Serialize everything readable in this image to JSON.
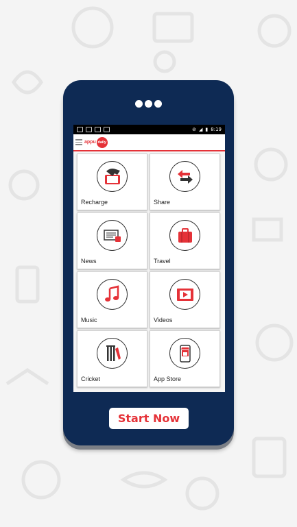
{
  "app": {
    "logo_text": "appu",
    "logo_badge": "daily"
  },
  "status": {
    "time": "8:19"
  },
  "tiles": [
    {
      "label": "Recharge",
      "icon": "recharge-icon"
    },
    {
      "label": "Share",
      "icon": "share-icon"
    },
    {
      "label": "News",
      "icon": "news-icon"
    },
    {
      "label": "Travel",
      "icon": "travel-icon"
    },
    {
      "label": "Music",
      "icon": "music-icon"
    },
    {
      "label": "Videos",
      "icon": "videos-icon"
    },
    {
      "label": "Cricket",
      "icon": "cricket-icon"
    },
    {
      "label": "App Store",
      "icon": "app-store-icon"
    }
  ],
  "cta": {
    "start_label": "Start Now"
  },
  "colors": {
    "accent": "#e53238",
    "phone_body": "#0e2a54",
    "background": "#f4f4f4"
  }
}
